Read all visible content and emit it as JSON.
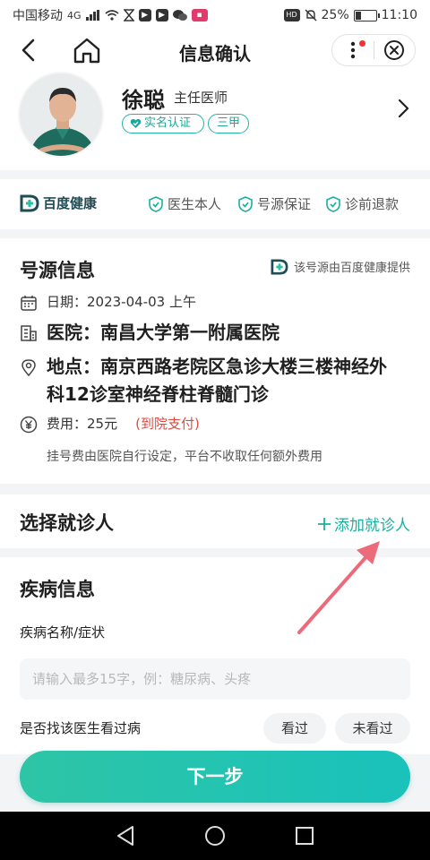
{
  "status_bar": {
    "carrier": "中国移动",
    "network": "4G",
    "battery": "25%",
    "time": "11:10"
  },
  "nav": {
    "title": "信息确认"
  },
  "doctor": {
    "name": "徐聪",
    "title": "主任医师",
    "badges": [
      "实名认证",
      "三甲"
    ]
  },
  "guarantee": {
    "brand": "百度健康",
    "items": [
      "医生本人",
      "号源保证",
      "诊前退款"
    ]
  },
  "source_info": {
    "title": "号源信息",
    "source_note": "该号源由百度健康提供",
    "date": "日期：2023-04-03 上午",
    "hospital": "医院：南昌大学第一附属医院",
    "location": "地点：南京西路老院区急诊大楼三楼神经外科12诊室神经脊柱脊髓门诊",
    "fee": "费用：25元",
    "fee_tag": "(到院支付)",
    "fee_note": "挂号费由医院自行设定，平台不收取任何额外费用"
  },
  "patient": {
    "title": "选择就诊人",
    "add_label": "添加就诊人"
  },
  "disease": {
    "title": "疾病信息",
    "field_label": "疾病名称/症状",
    "placeholder": "请输入最多15字，例：糖尿病、头疼",
    "visited_label": "是否找该医生看过病",
    "option_yes": "看过",
    "option_no": "未看过"
  },
  "next_button": "下一步",
  "colors": {
    "accent": "#1aaf9e",
    "fee_red": "#e04a3f",
    "annotation_arrow": "#ec6b7a"
  }
}
